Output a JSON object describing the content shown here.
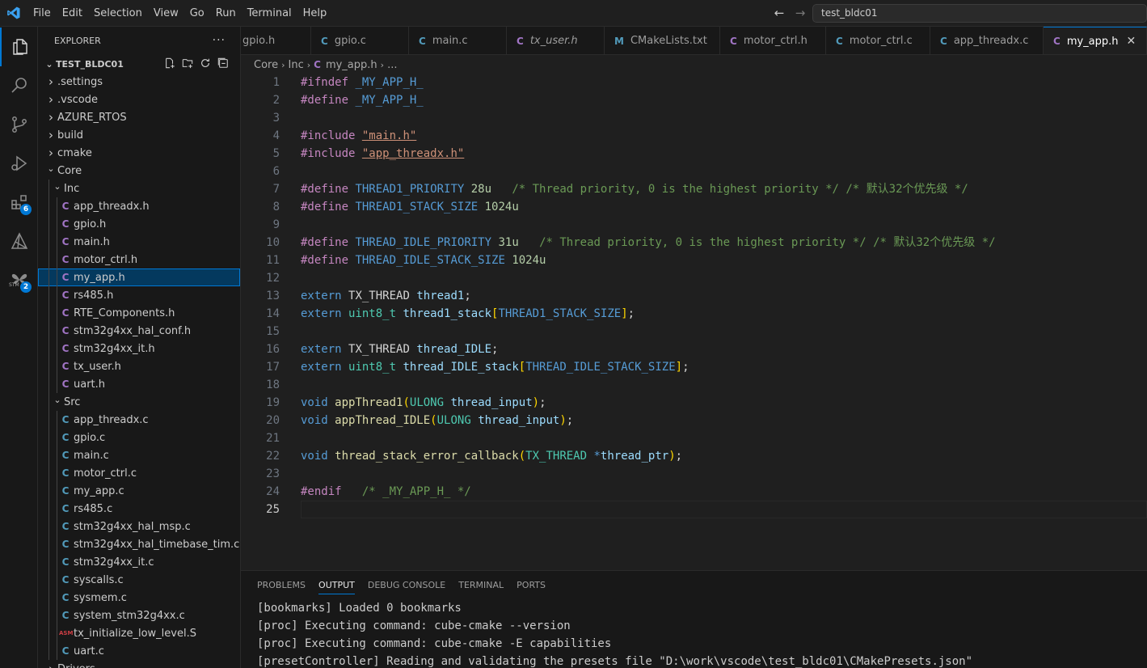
{
  "menu": [
    "File",
    "Edit",
    "Selection",
    "View",
    "Go",
    "Run",
    "Terminal",
    "Help"
  ],
  "command_center": "test_bldc01",
  "activity_badges": {
    "extensions": "6",
    "stm32": "2",
    "stm_label": "STM"
  },
  "explorer": {
    "title": "EXPLORER",
    "project": "TEST_BLDC01",
    "rows": [
      {
        "label": ".settings",
        "type": "folder",
        "depth": 1,
        "open": false
      },
      {
        "label": ".vscode",
        "type": "folder",
        "depth": 1,
        "open": false
      },
      {
        "label": "AZURE_RTOS",
        "type": "folder",
        "depth": 1,
        "open": false
      },
      {
        "label": "build",
        "type": "folder",
        "depth": 1,
        "open": false
      },
      {
        "label": "cmake",
        "type": "folder",
        "depth": 1,
        "open": false
      },
      {
        "label": "Core",
        "type": "folder",
        "depth": 1,
        "open": true
      },
      {
        "label": "Inc",
        "type": "folder",
        "depth": 2,
        "open": true
      },
      {
        "label": "app_threadx.h",
        "type": "h",
        "depth": 3
      },
      {
        "label": "gpio.h",
        "type": "h",
        "depth": 3
      },
      {
        "label": "main.h",
        "type": "h",
        "depth": 3
      },
      {
        "label": "motor_ctrl.h",
        "type": "h",
        "depth": 3
      },
      {
        "label": "my_app.h",
        "type": "h",
        "depth": 3,
        "selected": true
      },
      {
        "label": "rs485.h",
        "type": "h",
        "depth": 3
      },
      {
        "label": "RTE_Components.h",
        "type": "h",
        "depth": 3
      },
      {
        "label": "stm32g4xx_hal_conf.h",
        "type": "h",
        "depth": 3
      },
      {
        "label": "stm32g4xx_it.h",
        "type": "h",
        "depth": 3
      },
      {
        "label": "tx_user.h",
        "type": "h",
        "depth": 3
      },
      {
        "label": "uart.h",
        "type": "h",
        "depth": 3
      },
      {
        "label": "Src",
        "type": "folder",
        "depth": 2,
        "open": true
      },
      {
        "label": "app_threadx.c",
        "type": "c",
        "depth": 3
      },
      {
        "label": "gpio.c",
        "type": "c",
        "depth": 3
      },
      {
        "label": "main.c",
        "type": "c",
        "depth": 3
      },
      {
        "label": "motor_ctrl.c",
        "type": "c",
        "depth": 3
      },
      {
        "label": "my_app.c",
        "type": "c",
        "depth": 3
      },
      {
        "label": "rs485.c",
        "type": "c",
        "depth": 3
      },
      {
        "label": "stm32g4xx_hal_msp.c",
        "type": "c",
        "depth": 3
      },
      {
        "label": "stm32g4xx_hal_timebase_tim.c",
        "type": "c",
        "depth": 3
      },
      {
        "label": "stm32g4xx_it.c",
        "type": "c",
        "depth": 3
      },
      {
        "label": "syscalls.c",
        "type": "c",
        "depth": 3
      },
      {
        "label": "sysmem.c",
        "type": "c",
        "depth": 3
      },
      {
        "label": "system_stm32g4xx.c",
        "type": "c",
        "depth": 3
      },
      {
        "label": "tx_initialize_low_level.S",
        "type": "asm",
        "depth": 3
      },
      {
        "label": "uart.c",
        "type": "c",
        "depth": 3
      },
      {
        "label": "Drivers",
        "type": "folder",
        "depth": 1,
        "open": false
      }
    ]
  },
  "icon_letters": {
    "c": "C",
    "h": "C",
    "cmake": "M",
    "asm": "ASM"
  },
  "tabs": [
    {
      "label": "gpio.h",
      "type": "none",
      "width": 87
    },
    {
      "label": "gpio.c",
      "type": "c",
      "width": 121
    },
    {
      "label": "main.c",
      "type": "c",
      "width": 121
    },
    {
      "label": "tx_user.h",
      "type": "h",
      "width": 121,
      "italic": true
    },
    {
      "label": "CMakeLists.txt",
      "type": "m",
      "width": 143
    },
    {
      "label": "motor_ctrl.h",
      "type": "h",
      "width": 131
    },
    {
      "label": "motor_ctrl.c",
      "type": "c",
      "width": 129
    },
    {
      "label": "app_threadx.c",
      "type": "c",
      "width": 140
    },
    {
      "label": "my_app.h",
      "type": "h",
      "width": 128,
      "active": true
    }
  ],
  "breadcrumb": {
    "part1": "Core",
    "part2": "Inc",
    "file": "my_app.h",
    "tail": "..."
  },
  "code": {
    "l1_kw": "#ifndef",
    "l1_macro": "_MY_APP_H_",
    "l2_kw": "#define",
    "l2_macro": "_MY_APP_H_",
    "l4_kw": "#include",
    "l4_str": "\"main.h\"",
    "l5_kw": "#include",
    "l5_str": "\"app_threadx.h\"",
    "l7_kw": "#define",
    "l7_macro": "THREAD1_PRIORITY",
    "l7_num": "28u",
    "l7_cm": "/* Thread priority, 0 is the highest priority */ /* 默认32个优先级 */",
    "l8_kw": "#define",
    "l8_macro": "THREAD1_STACK_SIZE",
    "l8_num": "1024u",
    "l10_kw": "#define",
    "l10_macro": "THREAD_IDLE_PRIORITY",
    "l10_num": "31u",
    "l10_cm": "/* Thread priority, 0 is the highest priority */ /* 默认32个优先级 */",
    "l11_kw": "#define",
    "l11_macro": "THREAD_IDLE_STACK_SIZE",
    "l11_num": "1024u",
    "extern": "extern",
    "tx_thread": "TX_THREAD",
    "uint8": "uint8_t",
    "thread1": "thread1",
    "thread1_stack": "thread1_stack",
    "thread1_stack_size": "THREAD1_STACK_SIZE",
    "thread_idle": "thread_IDLE",
    "thread_idle_stack": "thread_IDLE_stack",
    "thread_idle_stack_size": "THREAD_IDLE_STACK_SIZE",
    "void": "void",
    "app_thread1": "appThread1",
    "app_thread_idle": "appThread_IDLE",
    "ulong": "ULONG",
    "thread_input": "thread_input",
    "cb_fn": "thread_stack_error_callback",
    "thread_ptr": "thread_ptr",
    "l24_kw": "#endif",
    "l24_cm": "/* _MY_APP_H_ */"
  },
  "panel": {
    "tabs": [
      "PROBLEMS",
      "OUTPUT",
      "DEBUG CONSOLE",
      "TERMINAL",
      "PORTS"
    ],
    "active": "OUTPUT",
    "lines": [
      "[bookmarks] Loaded 0 bookmarks",
      "[proc] Executing command: cube-cmake --version",
      "[proc] Executing command: cube-cmake -E capabilities",
      "[presetController] Reading and validating the presets file \"D:\\work\\vscode\\test_bldc01\\CMakePresets.json\""
    ]
  }
}
